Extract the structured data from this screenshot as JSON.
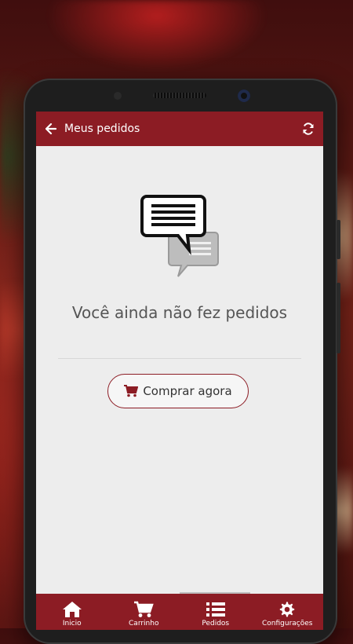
{
  "header": {
    "title": "Meus pedidos",
    "back_icon": "arrow-left-icon",
    "refresh_icon": "refresh-icon"
  },
  "empty_state": {
    "icon": "chat-bubbles-icon",
    "message": "Você ainda não fez pedidos",
    "button_label": "Comprar agora",
    "button_icon": "cart-icon"
  },
  "bottom_nav": {
    "items": [
      {
        "label": "Inicio",
        "icon": "home-icon"
      },
      {
        "label": "Carrinho",
        "icon": "cart-icon"
      },
      {
        "label": "Pedidos",
        "icon": "list-icon"
      },
      {
        "label": "Configurações",
        "icon": "gear-icon"
      }
    ]
  },
  "colors": {
    "primary": "#8c1c24",
    "background": "#ededed",
    "text": "#555555"
  }
}
